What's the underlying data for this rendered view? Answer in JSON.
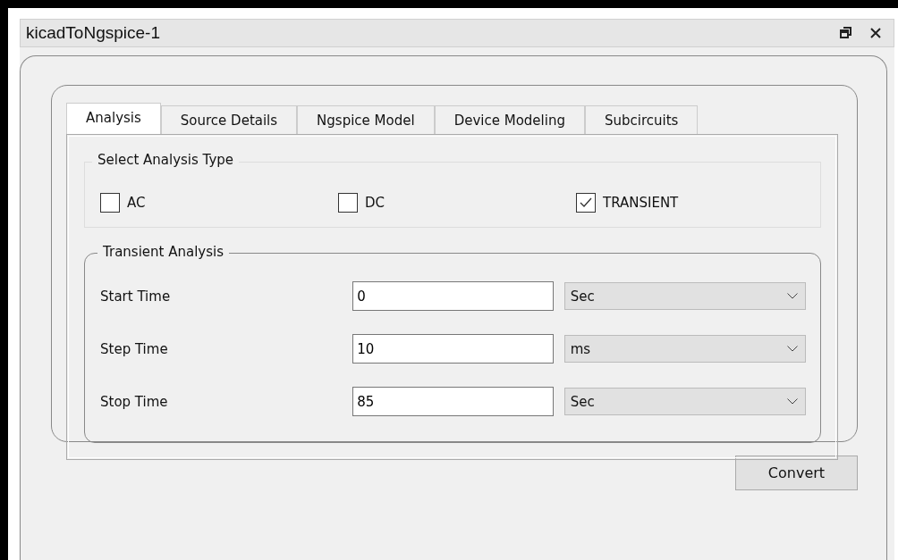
{
  "window": {
    "title": "kicadToNgspice-1"
  },
  "tabs": [
    {
      "label": "Analysis",
      "selected": true
    },
    {
      "label": "Source Details",
      "selected": false
    },
    {
      "label": "Ngspice Model",
      "selected": false
    },
    {
      "label": "Device Modeling",
      "selected": false
    },
    {
      "label": "Subcircuits",
      "selected": false
    }
  ],
  "analysis_type": {
    "title": "Select Analysis Type",
    "options": [
      {
        "label": "AC",
        "checked": false
      },
      {
        "label": "DC",
        "checked": false
      },
      {
        "label": "TRANSIENT",
        "checked": true
      }
    ]
  },
  "transient": {
    "title": "Transient Analysis",
    "rows": [
      {
        "label": "Start Time",
        "value": "0",
        "unit": "Sec"
      },
      {
        "label": "Step Time",
        "value": "10",
        "unit": "ms"
      },
      {
        "label": "Stop Time",
        "value": "85",
        "unit": "Sec"
      }
    ]
  },
  "buttons": [
    "Convert"
  ]
}
